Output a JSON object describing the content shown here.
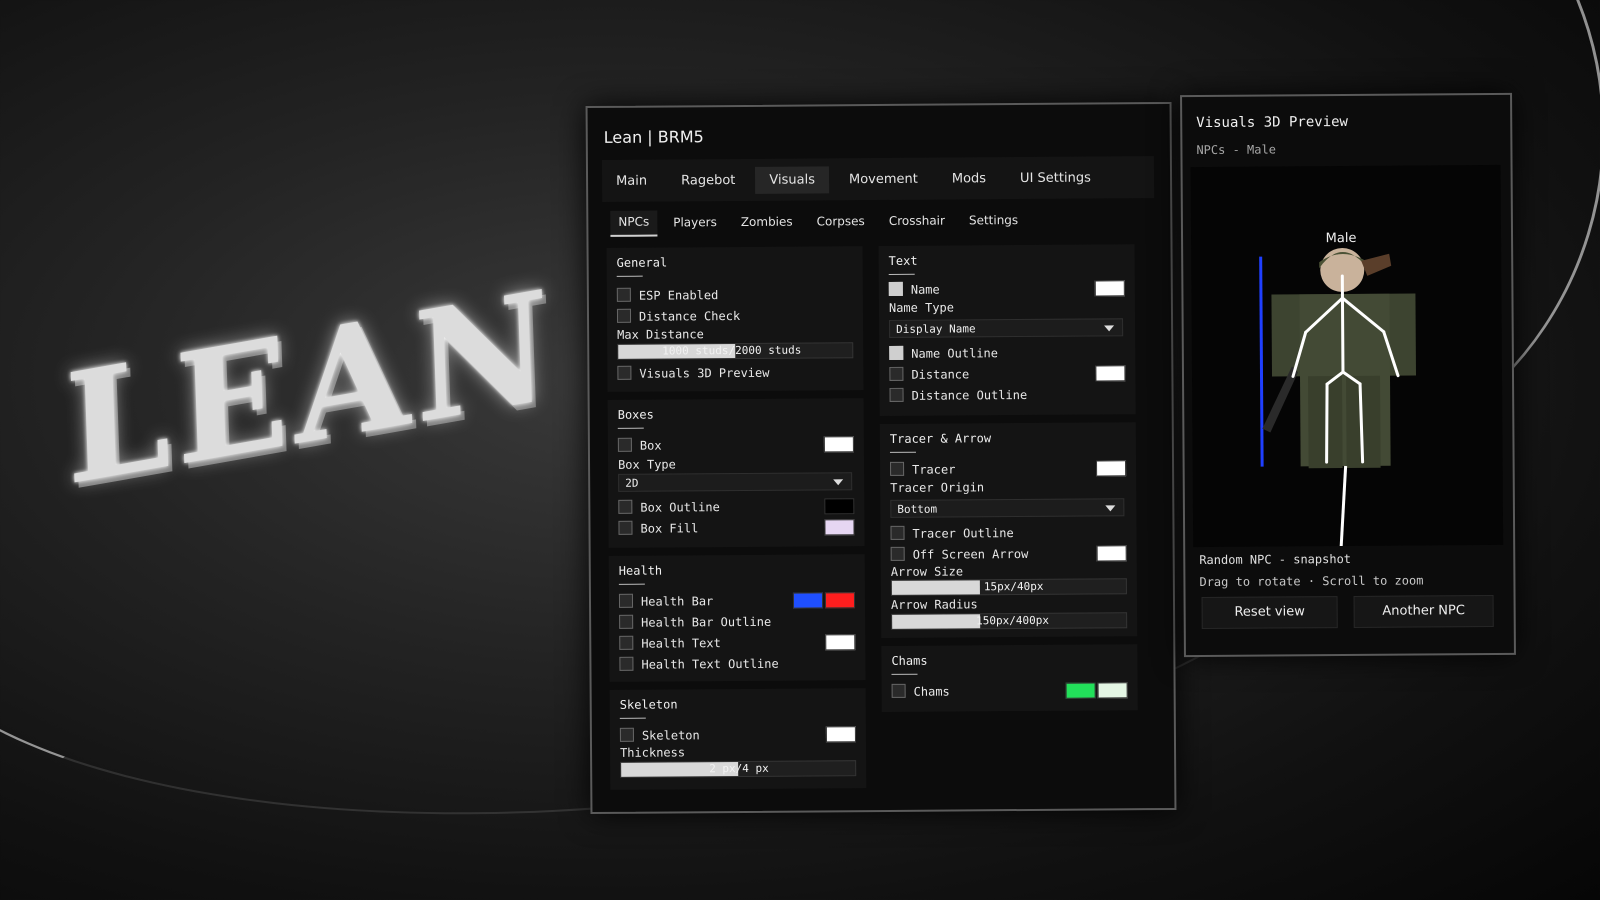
{
  "logo_text": "LEAN",
  "window": {
    "title": "Lean | BRM5"
  },
  "tabs": [
    {
      "label": "Main"
    },
    {
      "label": "Ragebot"
    },
    {
      "label": "Visuals"
    },
    {
      "label": "Movement"
    },
    {
      "label": "Mods"
    },
    {
      "label": "UI Settings"
    }
  ],
  "active_tab": "Visuals",
  "subtabs": [
    {
      "label": "NPCs"
    },
    {
      "label": "Players"
    },
    {
      "label": "Zombies"
    },
    {
      "label": "Corpses"
    },
    {
      "label": "Crosshair"
    },
    {
      "label": "Settings"
    }
  ],
  "active_subtab": "NPCs",
  "general": {
    "title": "General",
    "esp_enabled": "ESP Enabled",
    "distance_check": "Distance Check",
    "max_distance_label": "Max Distance",
    "max_distance_value": "1000 studs/2000 studs",
    "max_distance_fraction": 0.5,
    "visuals_3d_preview": "Visuals 3D Preview"
  },
  "boxes": {
    "title": "Boxes",
    "box": "Box",
    "box_color": "#ffffff",
    "box_type_label": "Box Type",
    "box_type_value": "2D",
    "box_outline": "Box Outline",
    "box_outline_color": "#000000",
    "box_fill": "Box Fill",
    "box_fill_color": "#e6d6f2"
  },
  "health": {
    "title": "Health",
    "health_bar": "Health Bar",
    "health_bar_color_full": "#1f4fff",
    "health_bar_color_low": "#ff1e1e",
    "health_bar_outline": "Health Bar Outline",
    "health_text": "Health Text",
    "health_text_color": "#ffffff",
    "health_text_outline": "Health Text Outline"
  },
  "skeleton": {
    "title": "Skeleton",
    "skeleton": "Skeleton",
    "skeleton_color": "#ffffff",
    "thickness_label": "Thickness",
    "thickness_value": "2 px/4 px",
    "thickness_fraction": 0.5
  },
  "text": {
    "title": "Text",
    "name": "Name",
    "name_color": "#ffffff",
    "name_type_label": "Name Type",
    "name_type_value": "Display Name",
    "name_outline": "Name Outline",
    "distance": "Distance",
    "distance_color": "#ffffff",
    "distance_outline": "Distance Outline"
  },
  "tracer": {
    "title": "Tracer & Arrow",
    "tracer": "Tracer",
    "tracer_color": "#ffffff",
    "tracer_origin_label": "Tracer Origin",
    "tracer_origin_value": "Bottom",
    "tracer_outline": "Tracer Outline",
    "off_screen_arrow": "Off Screen Arrow",
    "arrow_color": "#ffffff",
    "arrow_size_label": "Arrow Size",
    "arrow_size_value": "15px/40px",
    "arrow_size_fraction": 0.375,
    "arrow_radius_label": "Arrow Radius",
    "arrow_radius_value": "150px/400px",
    "arrow_radius_fraction": 0.375
  },
  "chams": {
    "title": "Chams",
    "chams": "Chams",
    "fill_color": "#22e05a",
    "outline_color": "#e4f6e4"
  },
  "preview": {
    "title": "Visuals 3D Preview",
    "subtitle": "NPCs - Male",
    "npc_name": "Male",
    "note": "Random NPC - snapshot",
    "hint": "Drag to rotate · Scroll to zoom",
    "reset_button": "Reset view",
    "another_button": "Another NPC"
  }
}
